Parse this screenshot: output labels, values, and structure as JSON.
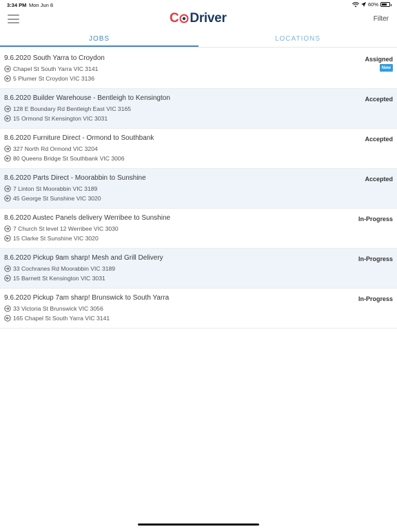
{
  "statusbar": {
    "time": "3:34 PM",
    "date": "Mon Jun 8",
    "battery": "60%"
  },
  "header": {
    "logo_c": "C",
    "logo_driver": "Driver",
    "filter_label": "Filter",
    "menu_icon": "hamburger-icon"
  },
  "tabs": [
    {
      "label": "JOBS",
      "active": true
    },
    {
      "label": "LOCATIONS",
      "active": false
    }
  ],
  "jobs": [
    {
      "title": "9.6.2020 South Yarra to Croydon",
      "pickup": "Chapel St South Yarra VIC 3141",
      "dropoff": "5 Plumer St Croydon VIC 3136",
      "status": "Assigned",
      "badge": "New"
    },
    {
      "title": "8.6.2020 Builder Warehouse - Bentleigh to Kensington",
      "pickup": "128 E Boundary Rd Bentleigh East VIC 3165",
      "dropoff": "15 Ormond St Kensington VIC 3031",
      "status": "Accepted"
    },
    {
      "title": "8.6.2020 Furniture Direct - Ormond to Southbank",
      "pickup": "327 North Rd Ormond VIC 3204",
      "dropoff": "80 Queens Bridge St Southbank VIC 3006",
      "status": "Accepted"
    },
    {
      "title": "8.6.2020 Parts Direct - Moorabbin to Sunshine",
      "pickup": "7 Linton St Moorabbin VIC 3189",
      "dropoff": "45 George St Sunshine VIC 3020",
      "status": "Accepted"
    },
    {
      "title": "8.6.2020 Austec Panels delivery Werribee to Sunshine",
      "pickup": "7 Church St level 12 Werribee VIC 3030",
      "dropoff": "15 Clarke St Sunshine VIC 3020",
      "status": "In-Progress"
    },
    {
      "title": "8.6.2020 Pickup 9am sharp! Mesh and Grill Delivery",
      "pickup": "33 Cochranes Rd Moorabbin VIC 3189",
      "dropoff": "15 Barnett St Kensington VIC 3031",
      "status": "In-Progress"
    },
    {
      "title": "9.6.2020 Pickup 7am sharp! Brunswick to South Yarra",
      "pickup": "33 Victoria St Brunswick VIC 3056",
      "dropoff": "165 Chapel St South Yarra VIC 3141",
      "status": "In-Progress"
    }
  ],
  "colors": {
    "accent": "#3a8cc4",
    "brand_red": "#e03a3e",
    "brand_navy": "#1b3a5c",
    "badge": "#2f9ee0",
    "alt_row": "#eef4fa"
  }
}
